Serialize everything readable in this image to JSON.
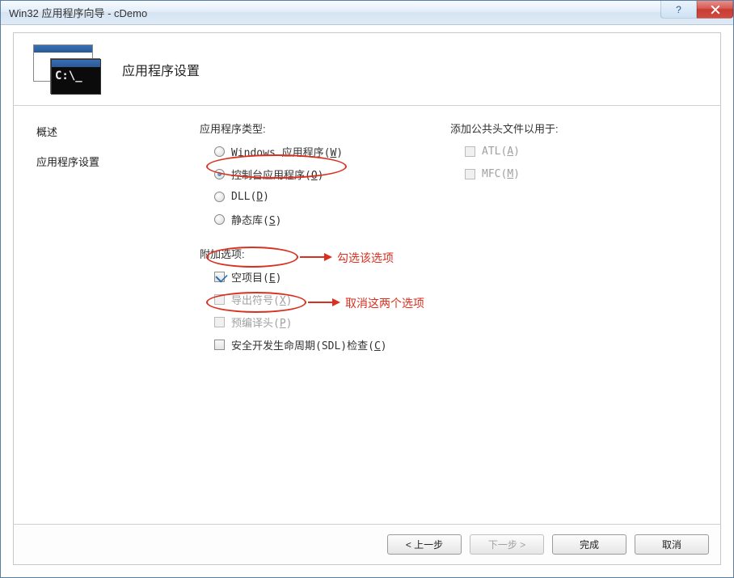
{
  "titlebar": {
    "title": "Win32 应用程序向导 - cDemo",
    "help_symbol": "?"
  },
  "header": {
    "title": "应用程序设置",
    "icon_prompt": "C:\\_"
  },
  "sidebar": {
    "items": [
      {
        "label": "概述"
      },
      {
        "label": "应用程序设置"
      }
    ]
  },
  "app_type": {
    "label": "应用程序类型:",
    "options": [
      {
        "label": "Windows 应用程序(",
        "hotkey": "W",
        "suffix": ")",
        "checked": false
      },
      {
        "label": "控制台应用程序(",
        "hotkey": "O",
        "suffix": ")",
        "checked": true
      },
      {
        "label": "DLL(",
        "hotkey": "D",
        "suffix": ")",
        "checked": false
      },
      {
        "label": "静态库(",
        "hotkey": "S",
        "suffix": ")",
        "checked": false
      }
    ]
  },
  "extra": {
    "label": "附加选项:",
    "options": [
      {
        "label": "空项目(",
        "hotkey": "E",
        "suffix": ")",
        "checked": true,
        "disabled": false
      },
      {
        "label": "导出符号(",
        "hotkey": "X",
        "suffix": ")",
        "checked": false,
        "disabled": true
      },
      {
        "label": "预编译头(",
        "hotkey": "P",
        "suffix": ")",
        "checked": false,
        "disabled": true
      },
      {
        "label": "安全开发生命周期(SDL)检查(",
        "hotkey": "C",
        "suffix": ")",
        "checked": false,
        "disabled": false
      }
    ]
  },
  "headers": {
    "label": "添加公共头文件以用于:",
    "options": [
      {
        "label": "ATL(",
        "hotkey": "A",
        "suffix": ")",
        "checked": false,
        "disabled": true
      },
      {
        "label": "MFC(",
        "hotkey": "M",
        "suffix": ")",
        "checked": false,
        "disabled": true
      }
    ]
  },
  "annotations": {
    "a1": "勾选该选项",
    "a2": "取消这两个选项"
  },
  "footer": {
    "prev": "< 上一步",
    "next": "下一步 >",
    "finish": "完成",
    "cancel": "取消"
  }
}
